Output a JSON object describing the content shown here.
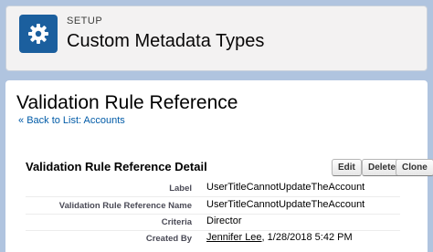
{
  "header": {
    "eyebrow": "SETUP",
    "title": "Custom Metadata Types",
    "icon": "gear-icon",
    "tile_color": "#1b5f9e"
  },
  "page": {
    "title": "Validation Rule Reference",
    "back_arrow": "«",
    "back_link": "Back to List: Accounts"
  },
  "detail": {
    "title": "Validation Rule Reference Detail",
    "buttons": {
      "edit": "Edit",
      "delete": "Delete",
      "clone": "Clone"
    },
    "fields": [
      {
        "label": "Label",
        "value": "UserTitleCannotUpdateTheAccount"
      },
      {
        "label": "Validation Rule Reference Name",
        "value": "UserTitleCannotUpdateTheAccount"
      },
      {
        "label": "Criteria",
        "value": "Director"
      },
      {
        "label": "Created By",
        "user": "Jennifer Lee",
        "date": ", 1/28/2018 5:42 PM"
      }
    ]
  },
  "colors": {
    "link": "#015ba7",
    "background": "#b0c4df"
  }
}
